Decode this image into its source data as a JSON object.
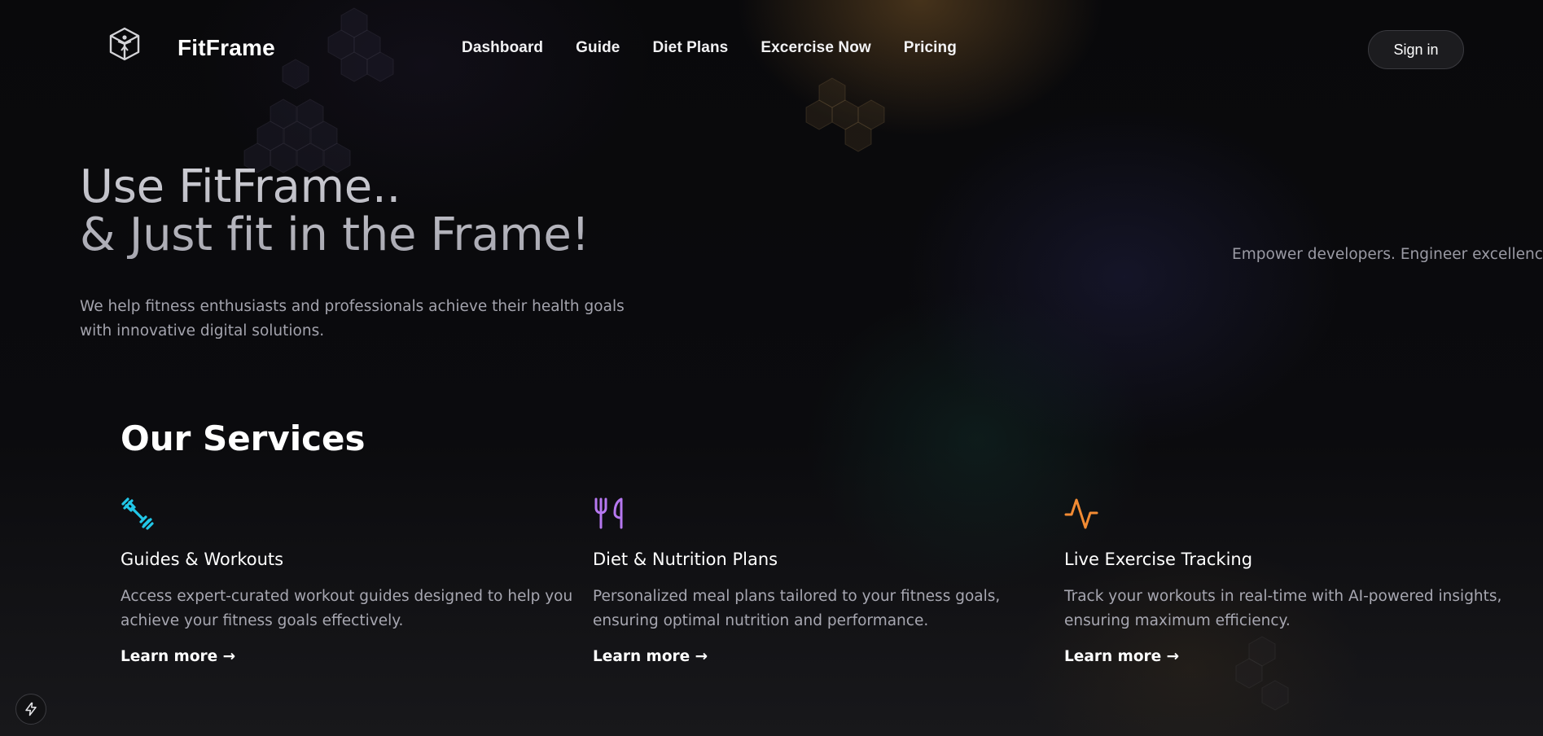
{
  "brand": {
    "name": "FitFrame",
    "logo_icon": "box-figure-icon"
  },
  "nav": {
    "items": [
      {
        "label": "Dashboard"
      },
      {
        "label": "Guide"
      },
      {
        "label": "Diet Plans"
      },
      {
        "label": "Excercise Now"
      },
      {
        "label": "Pricing"
      }
    ],
    "sign_in_label": "Sign in"
  },
  "hero": {
    "title_line1": "Use FitFrame..",
    "title_line2": "& Just fit in the Frame!",
    "subtitle": "We help fitness enthusiasts and professionals achieve their health goals with innovative digital solutions.",
    "tagline": "Empower developers. Engineer excellence."
  },
  "services": {
    "heading": "Our Services",
    "items": [
      {
        "icon": "dumbbell-icon",
        "icon_color": "#22c7e8",
        "title": "Guides & Workouts",
        "description": "Access expert-curated workout guides designed to help you achieve your fitness goals effectively.",
        "link_label": "Learn more →"
      },
      {
        "icon": "utensils-icon",
        "icon_color": "#b678f0",
        "title": "Diet & Nutrition Plans",
        "description": "Personalized meal plans tailored to your fitness goals, ensuring optimal nutrition and performance.",
        "link_label": "Learn more →"
      },
      {
        "icon": "activity-pulse-icon",
        "icon_color": "#f28b33",
        "title": "Live Exercise Tracking",
        "description": "Track your workouts in real-time with AI-powered insights, ensuring maximum efficiency.",
        "link_label": "Learn more →"
      }
    ]
  },
  "floating_button": {
    "icon": "lightning-bolt-icon"
  }
}
